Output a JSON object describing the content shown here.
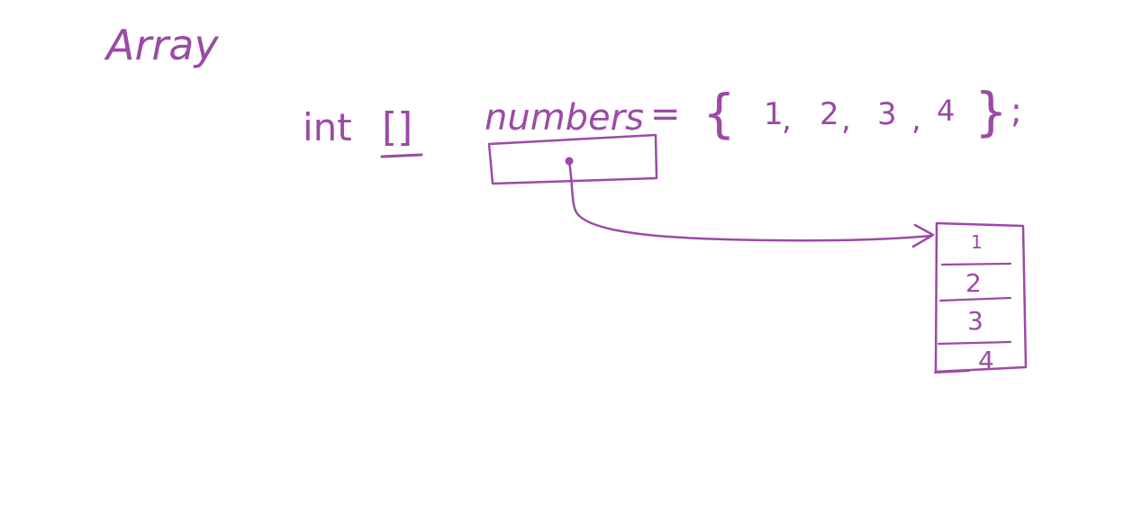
{
  "heading": "Array",
  "declaration": {
    "type": "int",
    "brackets": "[]",
    "variable": "numbers",
    "assign": "=",
    "open_brace": "{",
    "values": [
      "1",
      "2",
      "3",
      "4"
    ],
    "separator": ",",
    "close_brace": "}",
    "terminator": ";"
  },
  "memory_cells": [
    "1",
    "2",
    "3",
    "4"
  ],
  "ink_color": "#9b4aa5"
}
